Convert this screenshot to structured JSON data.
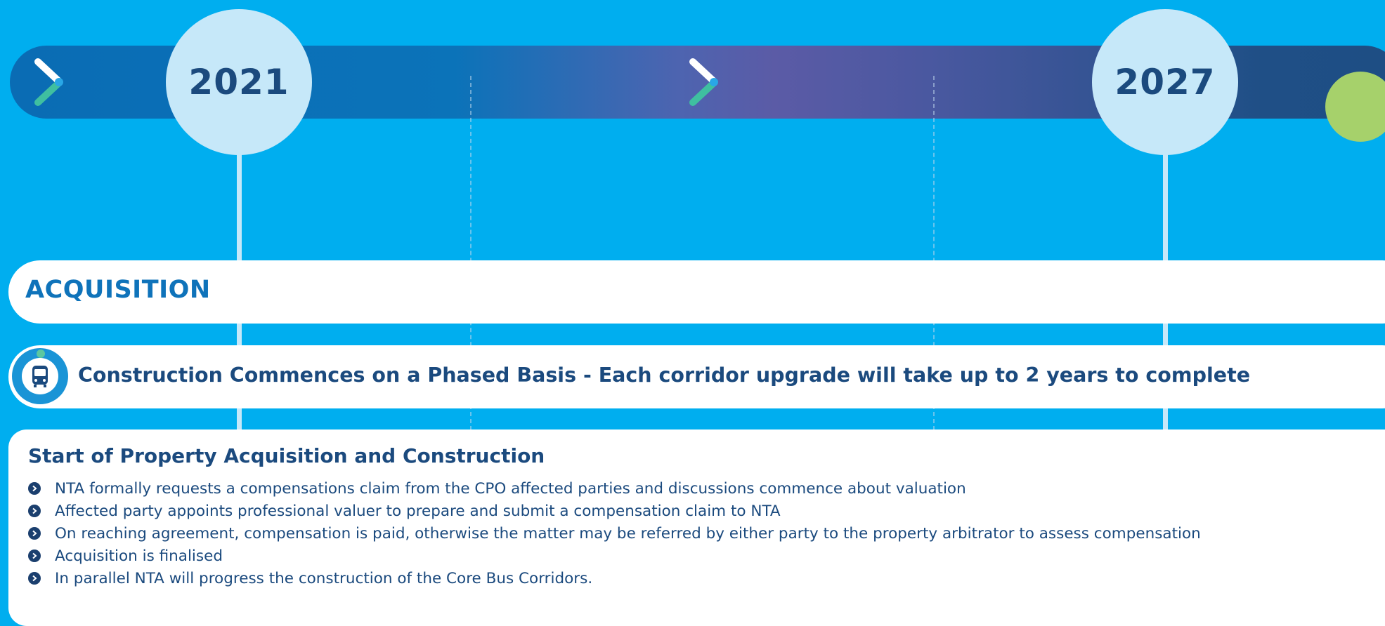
{
  "timeline": {
    "start_year": "2021",
    "end_year": "2027"
  },
  "acquisition": {
    "title": "ACQUISITION"
  },
  "construction": {
    "text": "Construction Commences on a Phased Basis - Each corridor upgrade will take up to 2 years to complete"
  },
  "property": {
    "heading": "Start of Property Acquisition and Construction",
    "bullets": [
      "NTA formally requests a compensations claim from the CPO affected parties and discussions commence about valuation",
      "Affected party appoints professional valuer to prepare and submit a compensation claim to NTA",
      "On reaching agreement, compensation is paid, otherwise the matter may be referred by either party to the property arbitrator to assess compensation",
      "Acquisition is finalised",
      "In parallel NTA will progress the construction of the Core Bus Corridors."
    ]
  },
  "colors": {
    "background": "#00aeef",
    "navy_text": "#1b4a7e",
    "accent_blue": "#0f73ba",
    "year_circle": "#c6e8f9",
    "end_marker": "#a6d16b"
  }
}
